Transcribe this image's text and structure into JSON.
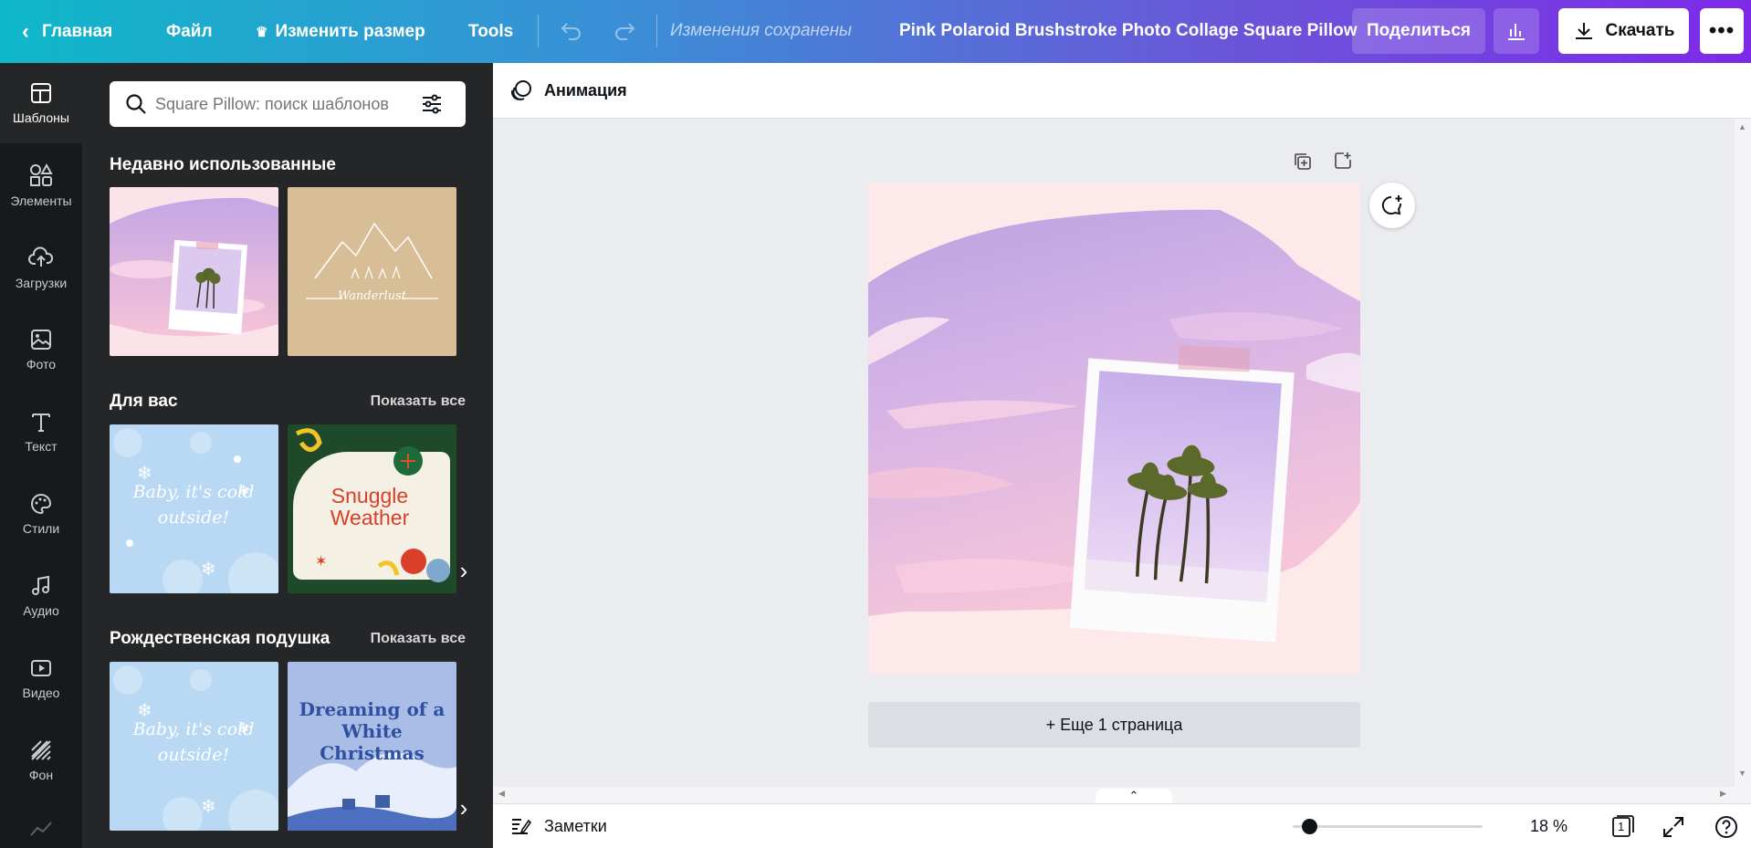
{
  "topbar": {
    "home_label": "Главная",
    "file_label": "Файл",
    "resize_label": "Изменить размер",
    "tools_label": "Tools",
    "save_status": "Изменения сохранены",
    "doc_title": "Pink Polaroid Brushstroke Photo Collage Square Pillow",
    "share_label": "Поделиться",
    "download_label": "Скачать"
  },
  "rail": {
    "items": [
      {
        "label": "Шаблоны",
        "icon": "templates-icon"
      },
      {
        "label": "Элементы",
        "icon": "elements-icon"
      },
      {
        "label": "Загрузки",
        "icon": "uploads-icon"
      },
      {
        "label": "Фото",
        "icon": "photo-icon"
      },
      {
        "label": "Текст",
        "icon": "text-icon"
      },
      {
        "label": "Стили",
        "icon": "palette-icon"
      },
      {
        "label": "Аудио",
        "icon": "audio-icon"
      },
      {
        "label": "Видео",
        "icon": "video-icon"
      },
      {
        "label": "Фон",
        "icon": "background-icon"
      }
    ]
  },
  "panel": {
    "search_placeholder": "Square Pillow: поиск шаблонов",
    "recent_title": "Недавно использованные",
    "for_you_title": "Для вас",
    "christmas_title": "Рождественская подушка",
    "show_all": "Показать все",
    "thumbs": {
      "wanderlust": "Wanderlust",
      "baby_cold": "Baby, it's cold outside!",
      "snuggle": "Snuggle Weather",
      "dreaming": "Dreaming of a White Christmas"
    }
  },
  "editor": {
    "animation_label": "Анимация",
    "add_page_label": "+ Еще 1 страница"
  },
  "bottombar": {
    "notes_label": "Заметки",
    "zoom": "18 %",
    "zoom_fraction": 0.05,
    "page_count": "1"
  },
  "colors": {
    "brand_gradient_start": "#0fb8c9",
    "brand_gradient_end": "#7d2ae8",
    "panel_bg": "#252627",
    "rail_bg": "#18191b"
  }
}
